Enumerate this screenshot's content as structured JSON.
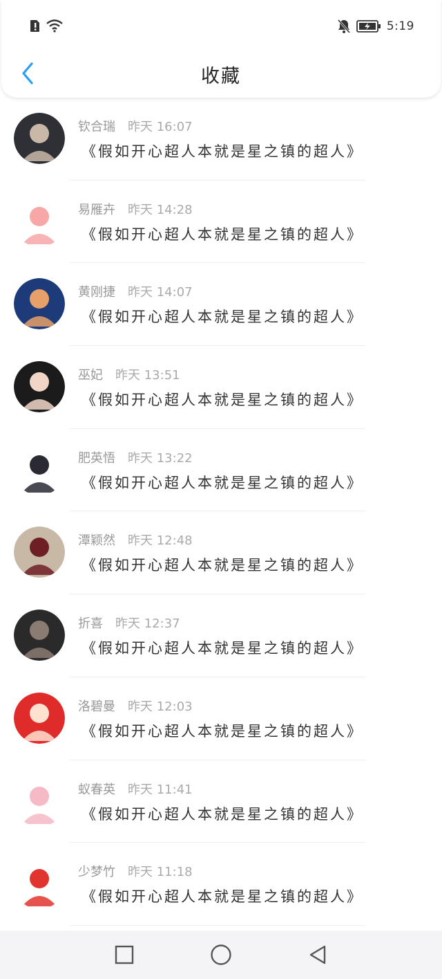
{
  "status_bar": {
    "time": "5:19"
  },
  "header": {
    "title": "收藏"
  },
  "favorites": [
    {
      "name": "钦合瑞",
      "time": "昨天 16:07",
      "content": "《假如开心超人本就是星之镇的超人》",
      "avatar_colors": [
        "#2f2f36",
        "#c9b8a8"
      ]
    },
    {
      "name": "易雁卉",
      "time": "昨天 14:28",
      "content": "《假如开心超人本就是星之镇的超人》",
      "avatar_colors": [
        "#ffffff",
        "#f7a7a7"
      ]
    },
    {
      "name": "黄刚捷",
      "time": "昨天 14:07",
      "content": "《假如开心超人本就是星之镇的超人》",
      "avatar_colors": [
        "#1d3b78",
        "#e8a06a"
      ]
    },
    {
      "name": "巫妃",
      "time": "昨天 13:51",
      "content": "《假如开心超人本就是星之镇的超人》",
      "avatar_colors": [
        "#1b1b1b",
        "#f1d6c8"
      ]
    },
    {
      "name": "肥英悟",
      "time": "昨天 13:22",
      "content": "《假如开心超人本就是星之镇的超人》",
      "avatar_colors": [
        "#ffffff",
        "#2a2a35"
      ]
    },
    {
      "name": "潭颖然",
      "time": "昨天 12:48",
      "content": "《假如开心超人本就是星之镇的超人》",
      "avatar_colors": [
        "#c7b9a6",
        "#6e1f26"
      ]
    },
    {
      "name": "折喜",
      "time": "昨天 12:37",
      "content": "《假如开心超人本就是星之镇的超人》",
      "avatar_colors": [
        "#2b2a2b",
        "#8a7b73"
      ]
    },
    {
      "name": "洛碧曼",
      "time": "昨天 12:03",
      "content": "《假如开心超人本就是星之镇的超人》",
      "avatar_colors": [
        "#e02b2b",
        "#ffe1d0"
      ]
    },
    {
      "name": "蚁春英",
      "time": "昨天 11:41",
      "content": "《假如开心超人本就是星之镇的超人》",
      "avatar_colors": [
        "#ffffff",
        "#f6b9c6"
      ]
    },
    {
      "name": "少梦竹",
      "time": "昨天 11:18",
      "content": "《假如开心超人本就是星之镇的超人》",
      "avatar_colors": [
        "#ffffff",
        "#e2342f"
      ]
    }
  ],
  "colors": {
    "accent": "#2a9df4",
    "meta_text": "#999999",
    "divider": "#f0f0f0"
  },
  "icons": {
    "back": "chevron-left-icon",
    "square": "square-nav-icon",
    "home": "circle-home-icon",
    "triangle": "triangle-back-icon"
  }
}
